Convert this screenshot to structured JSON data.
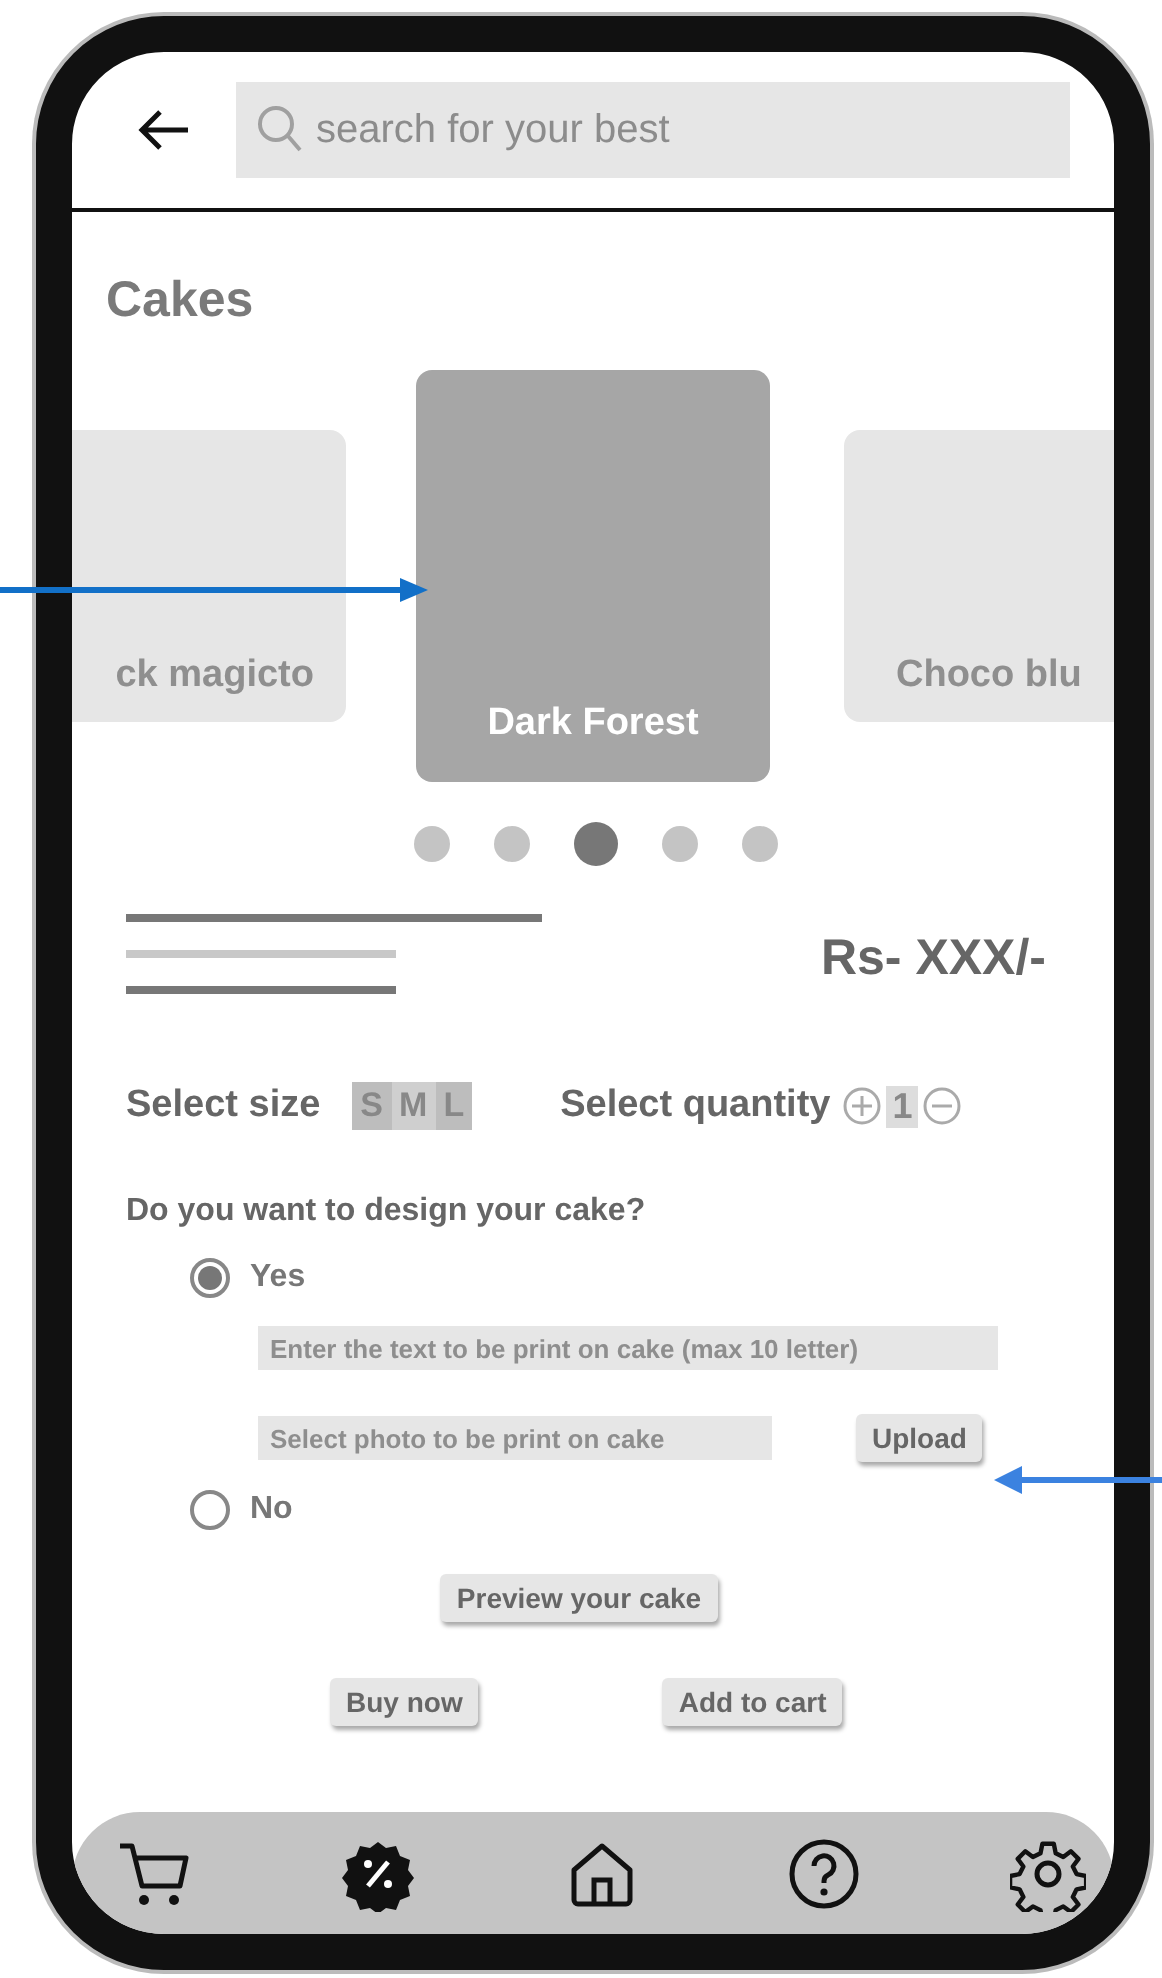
{
  "header": {
    "search": {
      "placeholder": "search for your best"
    }
  },
  "title": "Cakes",
  "carousel": {
    "cards": [
      {
        "name": "ck magicto",
        "selected": false
      },
      {
        "name": "Dark Forest",
        "selected": true
      },
      {
        "name": "Choco blu",
        "selected": false
      }
    ],
    "dots": [
      {
        "selected": false
      },
      {
        "selected": false
      },
      {
        "selected": true
      },
      {
        "selected": false
      },
      {
        "selected": false
      }
    ]
  },
  "price": "Rs- XXX/-",
  "size": {
    "label": "Select size",
    "options": [
      {
        "label": "S",
        "selected": false
      },
      {
        "label": "M",
        "selected": true
      },
      {
        "label": "L",
        "selected": false
      }
    ]
  },
  "quantity": {
    "label": "Select quantity",
    "value": "1"
  },
  "design": {
    "question": "Do you want to design your cake?",
    "options": [
      {
        "label": "Yes",
        "selected": true
      },
      {
        "label": "No",
        "selected": false
      }
    ],
    "text_field": {
      "placeholder": "Enter the text to be print on cake (max 10 letter)"
    },
    "photo_field": {
      "placeholder": "Select photo to be print on cake"
    },
    "upload_button": "Upload",
    "preview_button": "Preview your cake"
  },
  "actions": [
    "Buy now",
    "Add to cart"
  ],
  "nav": [
    {
      "kind": "cart"
    },
    {
      "kind": "offer"
    },
    {
      "kind": "home"
    },
    {
      "kind": "help"
    },
    {
      "kind": "settings"
    }
  ]
}
